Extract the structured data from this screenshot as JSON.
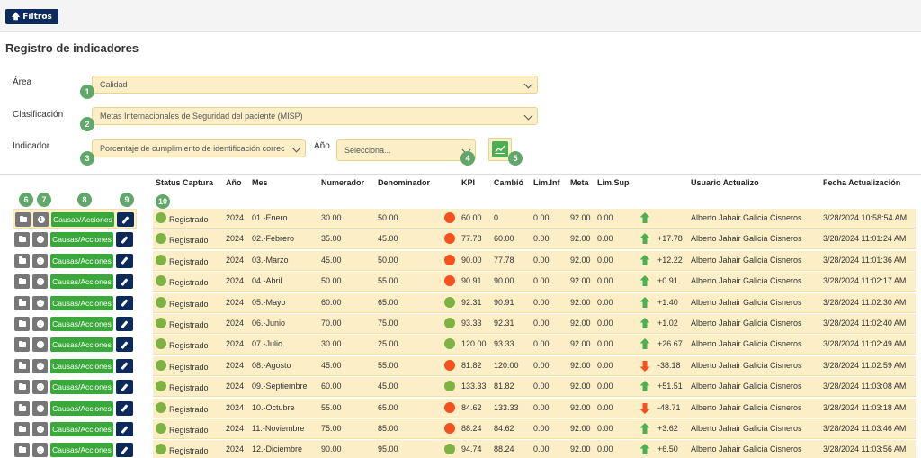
{
  "toolbar": {
    "filtros_label": "Filtros"
  },
  "page_title": "Registro de indicadores",
  "filters": {
    "area_label": "Área",
    "area_value": "Calidad",
    "clasificacion_label": "Clasificación",
    "clasificacion_value": "Metas Internacionales de Seguridad del paciente (MISP)",
    "indicador_label": "Indicador",
    "indicador_value": "Porcentaje de cumplimiento de identificación correc",
    "anio_label": "Año",
    "anio_value": "Selecciona..."
  },
  "badges": [
    "1",
    "2",
    "3",
    "4",
    "5",
    "6",
    "7",
    "8",
    "9",
    "10"
  ],
  "table": {
    "headers": [
      "Status Captura",
      "Año",
      "Mes",
      "Numerador",
      "Denominador",
      "KPI",
      "Cambió",
      "Lim.Inf",
      "Meta",
      "Lim.Sup",
      "Usuario Actualizo",
      "Fecha Actualización"
    ],
    "causas_label": "Causas/Acciones",
    "rows": [
      {
        "status": "Registrado",
        "anio": "2024",
        "mes": "01.-Enero",
        "num": "30.00",
        "den": "50.00",
        "kpi": "60.00",
        "kpi_color": "#f4511e",
        "cambio": "0",
        "liminf": "0.00",
        "meta": "92.00",
        "limsup": "0.00",
        "trend": "up",
        "delta": "",
        "usuario": "Alberto Jahair Galicia Cisneros",
        "fecha": "3/28/2024 10:58:54 AM"
      },
      {
        "status": "Registrado",
        "anio": "2024",
        "mes": "02.-Febrero",
        "num": "35.00",
        "den": "45.00",
        "kpi": "77.78",
        "kpi_color": "#f4511e",
        "cambio": "60.00",
        "liminf": "0.00",
        "meta": "92.00",
        "limsup": "0.00",
        "trend": "up",
        "delta": "+17.78",
        "usuario": "Alberto Jahair Galicia Cisneros",
        "fecha": "3/28/2024 11:01:24 AM"
      },
      {
        "status": "Registrado",
        "anio": "2024",
        "mes": "03.-Marzo",
        "num": "45.00",
        "den": "50.00",
        "kpi": "90.00",
        "kpi_color": "#f4511e",
        "cambio": "77.78",
        "liminf": "0.00",
        "meta": "92.00",
        "limsup": "0.00",
        "trend": "up",
        "delta": "+12.22",
        "usuario": "Alberto Jahair Galicia Cisneros",
        "fecha": "3/28/2024 11:01:36 AM"
      },
      {
        "status": "Registrado",
        "anio": "2024",
        "mes": "04.-Abril",
        "num": "50.00",
        "den": "55.00",
        "kpi": "90.91",
        "kpi_color": "#f4511e",
        "cambio": "90.00",
        "liminf": "0.00",
        "meta": "92.00",
        "limsup": "0.00",
        "trend": "up",
        "delta": "+0.91",
        "usuario": "Alberto Jahair Galicia Cisneros",
        "fecha": "3/28/2024 11:02:17 AM"
      },
      {
        "status": "Registrado",
        "anio": "2024",
        "mes": "05.-Mayo",
        "num": "60.00",
        "den": "65.00",
        "kpi": "92.31",
        "kpi_color": "#7cb342",
        "cambio": "90.91",
        "liminf": "0.00",
        "meta": "92.00",
        "limsup": "0.00",
        "trend": "up",
        "delta": "+1.40",
        "usuario": "Alberto Jahair Galicia Cisneros",
        "fecha": "3/28/2024 11:02:30 AM"
      },
      {
        "status": "Registrado",
        "anio": "2024",
        "mes": "06.-Junio",
        "num": "70.00",
        "den": "75.00",
        "kpi": "93.33",
        "kpi_color": "#7cb342",
        "cambio": "92.31",
        "liminf": "0.00",
        "meta": "92.00",
        "limsup": "0.00",
        "trend": "up",
        "delta": "+1.02",
        "usuario": "Alberto Jahair Galicia Cisneros",
        "fecha": "3/28/2024 11:02:40 AM"
      },
      {
        "status": "Registrado",
        "anio": "2024",
        "mes": "07.-Julio",
        "num": "30.00",
        "den": "25.00",
        "kpi": "120.00",
        "kpi_color": "#7cb342",
        "cambio": "93.33",
        "liminf": "0.00",
        "meta": "92.00",
        "limsup": "0.00",
        "trend": "up",
        "delta": "+26.67",
        "usuario": "Alberto Jahair Galicia Cisneros",
        "fecha": "3/28/2024 11:02:49 AM"
      },
      {
        "status": "Registrado",
        "anio": "2024",
        "mes": "08.-Agosto",
        "num": "45.00",
        "den": "55.00",
        "kpi": "81.82",
        "kpi_color": "#f4511e",
        "cambio": "120.00",
        "liminf": "0.00",
        "meta": "92.00",
        "limsup": "0.00",
        "trend": "down",
        "delta": "-38.18",
        "usuario": "Alberto Jahair Galicia Cisneros",
        "fecha": "3/28/2024 11:02:59 AM"
      },
      {
        "status": "Registrado",
        "anio": "2024",
        "mes": "09.-Septiembre",
        "num": "60.00",
        "den": "45.00",
        "kpi": "133.33",
        "kpi_color": "#7cb342",
        "cambio": "81.82",
        "liminf": "0.00",
        "meta": "92.00",
        "limsup": "0.00",
        "trend": "up",
        "delta": "+51.51",
        "usuario": "Alberto Jahair Galicia Cisneros",
        "fecha": "3/28/2024 11:03:08 AM"
      },
      {
        "status": "Registrado",
        "anio": "2024",
        "mes": "10.-Octubre",
        "num": "55.00",
        "den": "65.00",
        "kpi": "84.62",
        "kpi_color": "#f4511e",
        "cambio": "133.33",
        "liminf": "0.00",
        "meta": "92.00",
        "limsup": "0.00",
        "trend": "down",
        "delta": "-48.71",
        "usuario": "Alberto Jahair Galicia Cisneros",
        "fecha": "3/28/2024 11:03:18 AM"
      },
      {
        "status": "Registrado",
        "anio": "2024",
        "mes": "11.-Noviembre",
        "num": "75.00",
        "den": "85.00",
        "kpi": "88.24",
        "kpi_color": "#f4511e",
        "cambio": "84.62",
        "liminf": "0.00",
        "meta": "92.00",
        "limsup": "0.00",
        "trend": "up",
        "delta": "+3.62",
        "usuario": "Alberto Jahair Galicia Cisneros",
        "fecha": "3/28/2024 11:03:46 AM"
      },
      {
        "status": "Registrado",
        "anio": "2024",
        "mes": "12.-Diciembre",
        "num": "90.00",
        "den": "95.00",
        "kpi": "94.74",
        "kpi_color": "#7cb342",
        "cambio": "88.24",
        "liminf": "0.00",
        "meta": "92.00",
        "limsup": "0.00",
        "trend": "up",
        "delta": "+6.50",
        "usuario": "Alberto Jahair Galicia Cisneros",
        "fecha": "3/28/2024 11:03:56 AM"
      }
    ]
  }
}
